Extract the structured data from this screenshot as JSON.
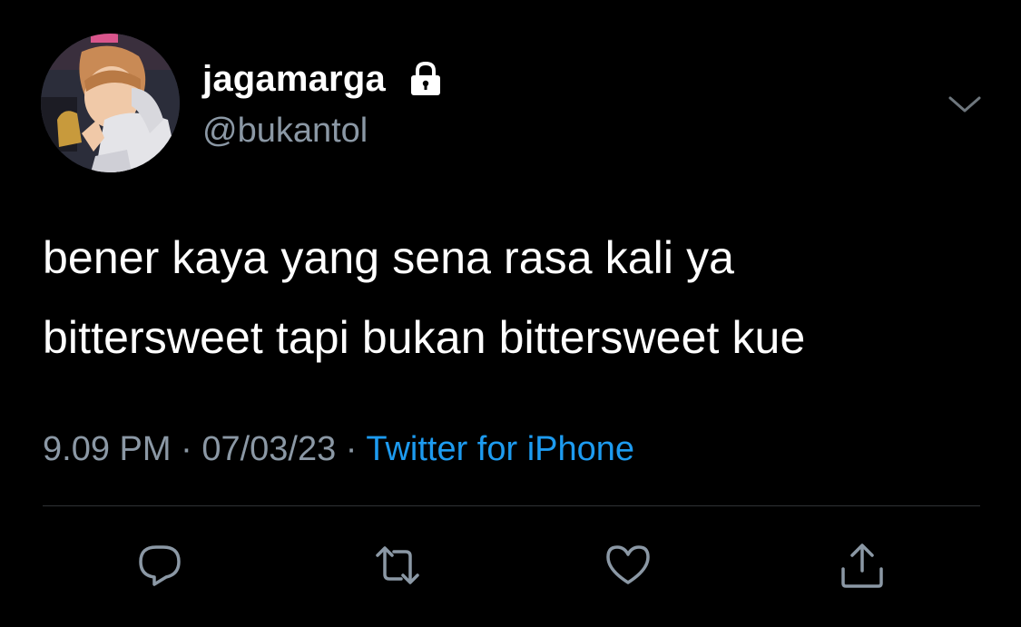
{
  "tweet": {
    "author": {
      "display_name": "jagamarga",
      "handle": "@bukantol",
      "protected_icon": "lock-icon",
      "avatar": "profile-photo"
    },
    "text_lines": [
      "bener kaya yang sena rasa kali ya",
      "bittersweet tapi bukan bittersweet kue"
    ],
    "meta": {
      "time": "9.09 PM",
      "separator": " · ",
      "date": "07/03/23",
      "source": "Twitter for iPhone"
    },
    "menu_icon": "chevron-down-icon",
    "actions": [
      {
        "name": "reply",
        "icon": "reply-icon"
      },
      {
        "name": "retweet",
        "icon": "retweet-icon"
      },
      {
        "name": "like",
        "icon": "heart-icon"
      },
      {
        "name": "share",
        "icon": "share-icon"
      }
    ]
  },
  "colors": {
    "background": "#000000",
    "text_primary": "#ffffff",
    "text_secondary": "#8b98a5",
    "link": "#1d9bf0",
    "divider": "#2f3336"
  }
}
